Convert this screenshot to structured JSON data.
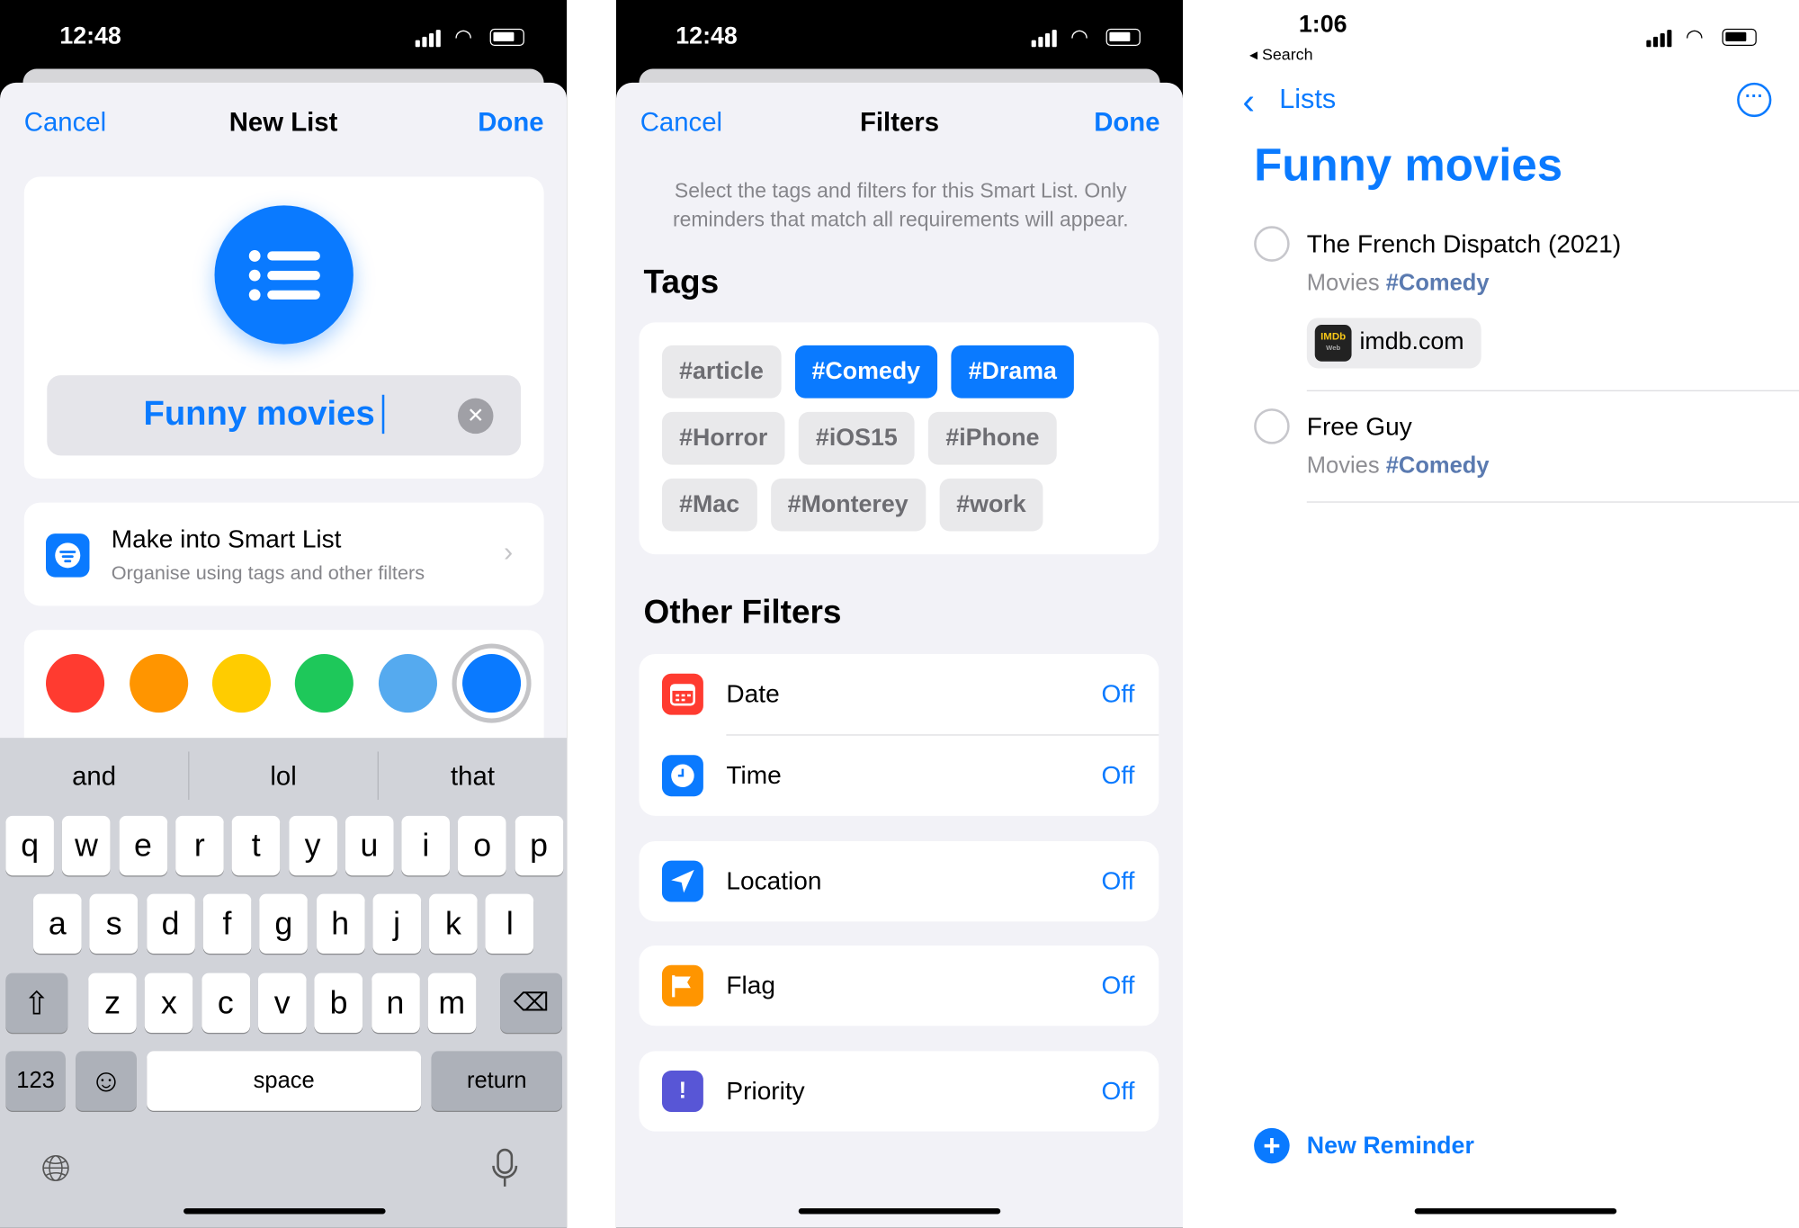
{
  "left": {
    "status": {
      "time": "12:48"
    },
    "nav": {
      "cancel": "Cancel",
      "title": "New List",
      "done": "Done"
    },
    "list_icon": "list-bullet-icon",
    "name_input": {
      "value": "Funny movies"
    },
    "smart_list": {
      "title": "Make into Smart List",
      "subtitle": "Organise using tags and other filters"
    },
    "colors": [
      "#ff3b30",
      "#ff9500",
      "#ffcc00",
      "#1ec85a",
      "#55aaef",
      "#0a7aff"
    ],
    "selected_color": "#0a7aff",
    "keyboard": {
      "suggestions": [
        "and",
        "lol",
        "that"
      ],
      "row1": [
        "q",
        "w",
        "e",
        "r",
        "t",
        "y",
        "u",
        "i",
        "o",
        "p"
      ],
      "row2": [
        "a",
        "s",
        "d",
        "f",
        "g",
        "h",
        "j",
        "k",
        "l"
      ],
      "row3": [
        "z",
        "x",
        "c",
        "v",
        "b",
        "n",
        "m"
      ],
      "numbers": "123",
      "space": "space",
      "return": "return"
    }
  },
  "middle": {
    "status": {
      "time": "12:48"
    },
    "nav": {
      "cancel": "Cancel",
      "title": "Filters",
      "done": "Done"
    },
    "description": "Select the tags and filters for this Smart List. Only reminders that match all requirements will appear.",
    "tags_heading": "Tags",
    "tags": [
      {
        "label": "#article",
        "selected": false
      },
      {
        "label": "#Comedy",
        "selected": true
      },
      {
        "label": "#Drama",
        "selected": true
      },
      {
        "label": "#Horror",
        "selected": false
      },
      {
        "label": "#iOS15",
        "selected": false
      },
      {
        "label": "#iPhone",
        "selected": false
      },
      {
        "label": "#Mac",
        "selected": false
      },
      {
        "label": "#Monterey",
        "selected": false
      },
      {
        "label": "#work",
        "selected": false
      }
    ],
    "other_heading": "Other Filters",
    "filters": [
      {
        "label": "Date",
        "value": "Off",
        "icon": "calendar-icon",
        "color": "#ff3b30"
      },
      {
        "label": "Time",
        "value": "Off",
        "icon": "clock-icon",
        "color": "#0a7aff"
      },
      {
        "label": "Location",
        "value": "Off",
        "icon": "location-arrow-icon",
        "color": "#0a7aff"
      },
      {
        "label": "Flag",
        "value": "Off",
        "icon": "flag-icon",
        "color": "#ff9500"
      },
      {
        "label": "Priority",
        "value": "Off",
        "icon": "exclamation-icon",
        "color": "#5856d6"
      }
    ]
  },
  "right": {
    "status": {
      "time": "1:06",
      "back_app": "Search"
    },
    "nav": {
      "back": "Lists"
    },
    "title": "Funny movies",
    "reminders": [
      {
        "title": "The French Dispatch (2021)",
        "list": "Movies",
        "tag": "#Comedy",
        "link": {
          "label": "imdb.com",
          "logo": "IMDb",
          "logo_sub": "Web"
        }
      },
      {
        "title": "Free Guy",
        "list": "Movies",
        "tag": "#Comedy"
      }
    ],
    "new_reminder": "New Reminder",
    "accent": "#0a7aff"
  }
}
